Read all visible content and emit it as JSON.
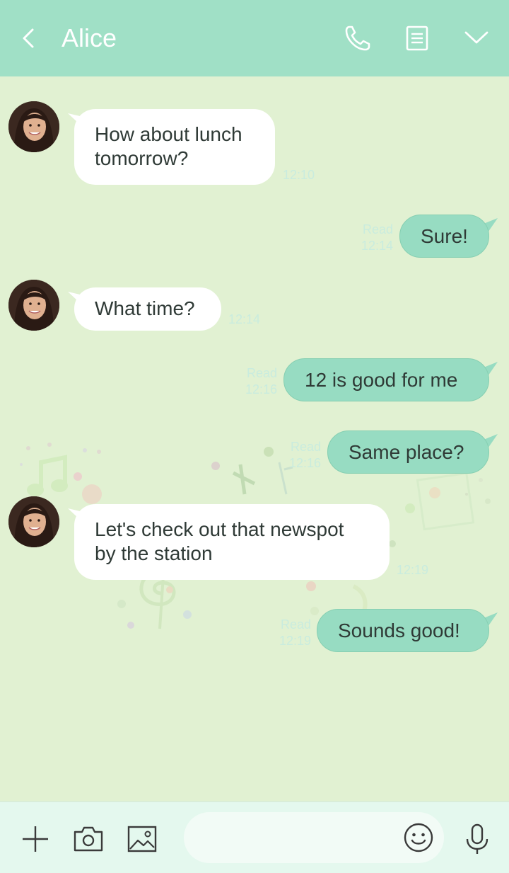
{
  "header": {
    "title": "Alice",
    "back_icon": "chevron-left-icon",
    "call_icon": "phone-icon",
    "notes_icon": "document-icon",
    "menu_icon": "chevron-down-icon",
    "color": "#a0e0c6"
  },
  "chat": {
    "background_color": "#e1f1d2",
    "messages": [
      {
        "direction": "in",
        "lines": [
          "How about lunch",
          "tomorrow?"
        ],
        "time": "12:10"
      },
      {
        "direction": "out",
        "lines": [
          "Sure!"
        ],
        "status": "Read",
        "time": "12:14"
      },
      {
        "direction": "in",
        "lines": [
          "What time?"
        ],
        "time": "12:14"
      },
      {
        "direction": "out",
        "lines": [
          "12 is good for me"
        ],
        "status": "Read",
        "time": "12:16"
      },
      {
        "direction": "out",
        "lines": [
          "Same place?"
        ],
        "status": "Read",
        "time": "12:16"
      },
      {
        "direction": "in",
        "lines": [
          "Let's check out that newspot",
          "by the station"
        ],
        "time": "12:19"
      },
      {
        "direction": "out",
        "lines": [
          "Sounds good!"
        ],
        "status": "Read",
        "time": "12:19"
      }
    ]
  },
  "bottombar": {
    "add_icon": "plus-icon",
    "camera_icon": "camera-icon",
    "gallery_icon": "image-icon",
    "input_value": "",
    "emoji_icon": "smiley-icon",
    "mic_icon": "microphone-icon"
  },
  "colors": {
    "outgoing_bubble": "#97dcc2",
    "incoming_bubble": "#ffffff",
    "timestamp": "#c9ecde"
  }
}
